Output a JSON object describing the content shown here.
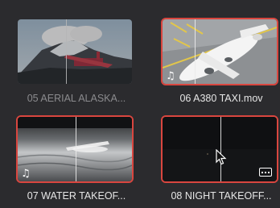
{
  "clips": [
    {
      "name": "05 AERIAL  ALASKA...",
      "selected": false
    },
    {
      "name": "06 A380 TAXI.mov",
      "selected": true
    },
    {
      "name": "07 WATER TAKEOF...",
      "selected": true
    },
    {
      "name": "08 NIGHT TAKEOFF...",
      "selected": true
    }
  ],
  "icons": {
    "audio": "music-note-icon",
    "more": "more-options-icon",
    "pointer": "mouse-pointer-icon"
  },
  "colors": {
    "selection_border": "#d9463f",
    "background": "#2b2b2e"
  }
}
